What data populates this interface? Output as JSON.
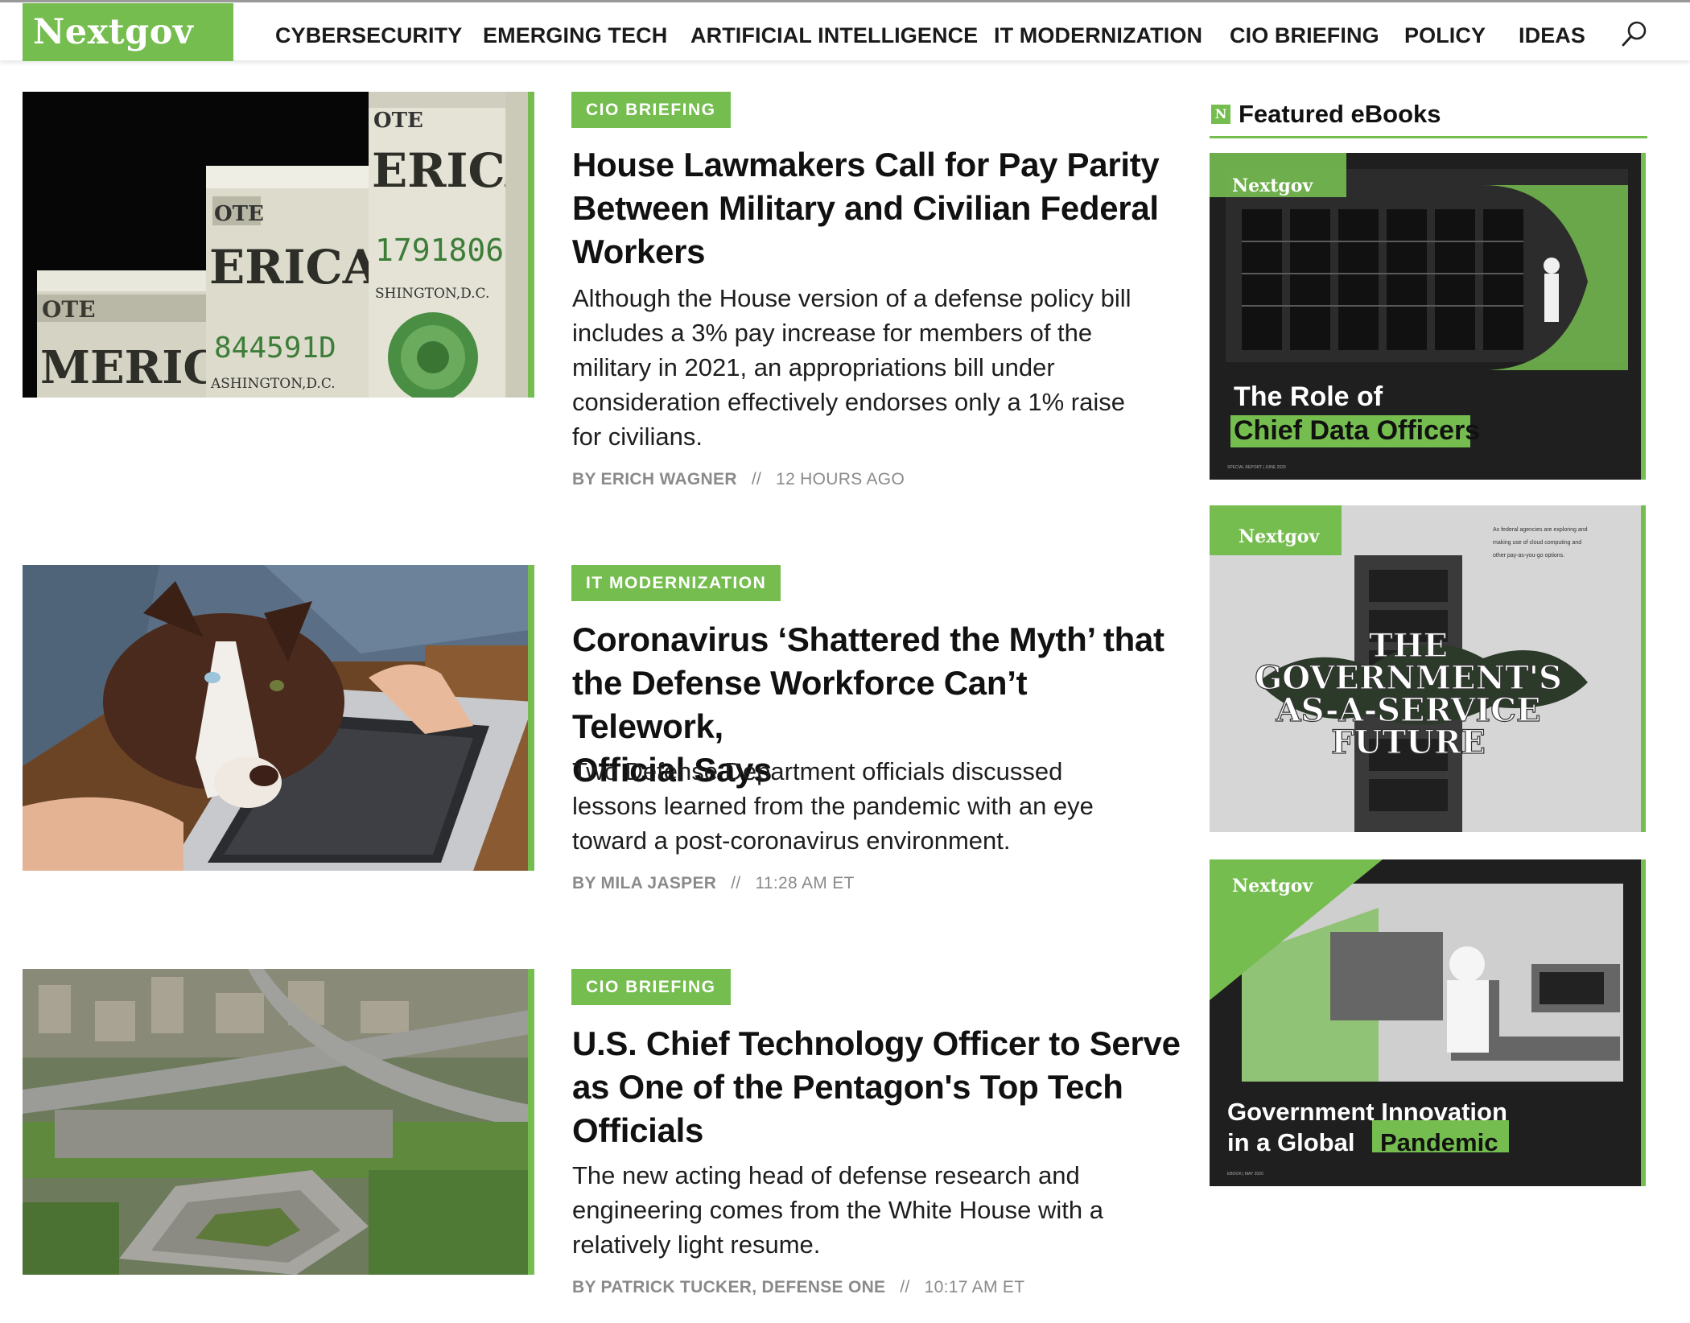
{
  "site": {
    "name": "Nextgov"
  },
  "nav": {
    "items": [
      "CYBERSECURITY",
      "EMERGING TECH",
      "ARTIFICIAL INTELLIGENCE",
      "IT MODERNIZATION",
      "CIO BRIEFING",
      "POLICY",
      "IDEAS"
    ]
  },
  "articles": [
    {
      "tag": "CIO BRIEFING",
      "title_lines": [
        "House Lawmakers Call for Pay Parity",
        "Between Military and Civilian Federal",
        "Workers"
      ],
      "summary_lines": [
        "Although the House version of a defense policy bill",
        "includes a 3% pay increase for members of the",
        "military in 2021, an appropriations bill under",
        "consideration effectively endorses only a 1% raise",
        "for civilians."
      ],
      "author": "BY ERICH WAGNER",
      "separator": "//",
      "time": "12 HOURS AGO",
      "image_text": {
        "erica_large": "ERICA",
        "serial": "1791806",
        "city_top": "SHINGTON,D.C.",
        "erica_mid": "ERICA",
        "serial_mid": "844591D",
        "city_mid": "ASHINGTON,D.C.",
        "erica_small": "MERICA",
        "note_small": "OTE",
        "note_mid": "OTE",
        "note_large": "OTE"
      }
    },
    {
      "tag": "IT MODERNIZATION",
      "title_lines": [
        "Coronavirus ‘Shattered the Myth’ that",
        "the Defense Workforce Can’t Telework,",
        "Official Says"
      ],
      "summary_lines": [
        "Two Defense Department officials discussed",
        "lessons learned from the pandemic with an eye",
        "toward a post-coronavirus environment."
      ],
      "author": "BY MILA JASPER",
      "separator": "//",
      "time": "11:28 AM ET"
    },
    {
      "tag": "CIO BRIEFING",
      "title_lines": [
        "U.S. Chief Technology Officer to Serve",
        "as One of the Pentagon's Top Tech",
        "Officials"
      ],
      "summary_lines": [
        "The new acting head of defense research and",
        "engineering comes from the White House with a",
        "relatively light resume."
      ],
      "author": "BY PATRICK TUCKER, DEFENSE ONE",
      "separator": "//",
      "time": "10:17 AM ET"
    }
  ],
  "sidebar": {
    "badge": "N",
    "title": "Featured eBooks",
    "ebooks": [
      {
        "brand": "Nextgov",
        "title_line1": "The Role of",
        "title_line2": "Chief Data Officers",
        "footer": "SPECIAL REPORT | JUNE 2020"
      },
      {
        "brand": "Nextgov",
        "title_lines": [
          "THE",
          "GOVERNMENT'S",
          "AS-A-SERVICE",
          "FUTURE"
        ],
        "blurb_lines": [
          "As federal agencies are exploring and",
          "making use of cloud computing and",
          "other pay-as-you-go options."
        ]
      },
      {
        "brand": "Nextgov",
        "title_line1": "Government Innovation",
        "title_line2a": "in a Global",
        "title_line2b": "Pandemic",
        "footer": "EBOOK | MAY 2020"
      }
    ]
  },
  "colors": {
    "brand_green": "#76bd50",
    "text": "#111111",
    "meta_gray": "#8a8a8a"
  },
  "icons": {
    "search": "search-icon"
  }
}
